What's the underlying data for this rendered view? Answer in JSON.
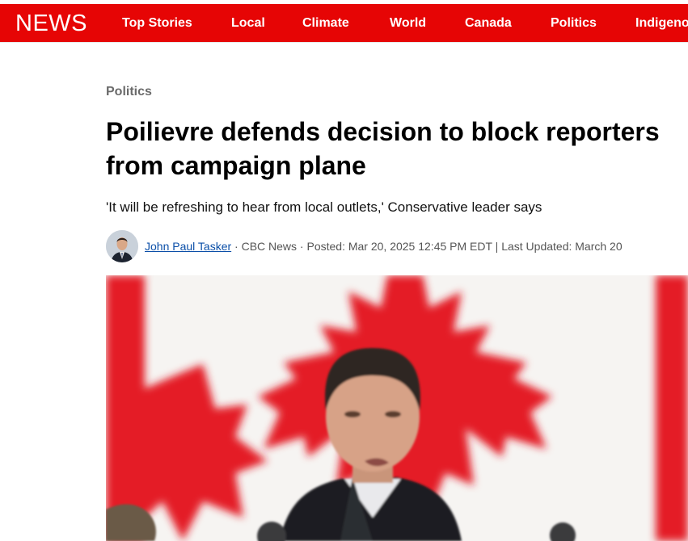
{
  "nav": {
    "logo": "NEWS",
    "items": [
      "Top Stories",
      "Local",
      "Climate",
      "World",
      "Canada",
      "Politics",
      "Indigenous"
    ]
  },
  "article": {
    "section": "Politics",
    "headline": "Poilievre defends decision to block reporters from campaign plane",
    "deck": "'It will be refreshing to hear from local outlets,' Conservative leader says",
    "author": "John Paul Tasker",
    "byline_rest": " · CBC News · Posted: Mar 20, 2025 12:45 PM EDT | Last Updated: March 20"
  },
  "colors": {
    "brand_red": "#e60505",
    "link_blue": "#0b4fa8"
  },
  "icons": {
    "avatar": "author-headshot",
    "hero": "maple-leaf-flag-photo"
  }
}
